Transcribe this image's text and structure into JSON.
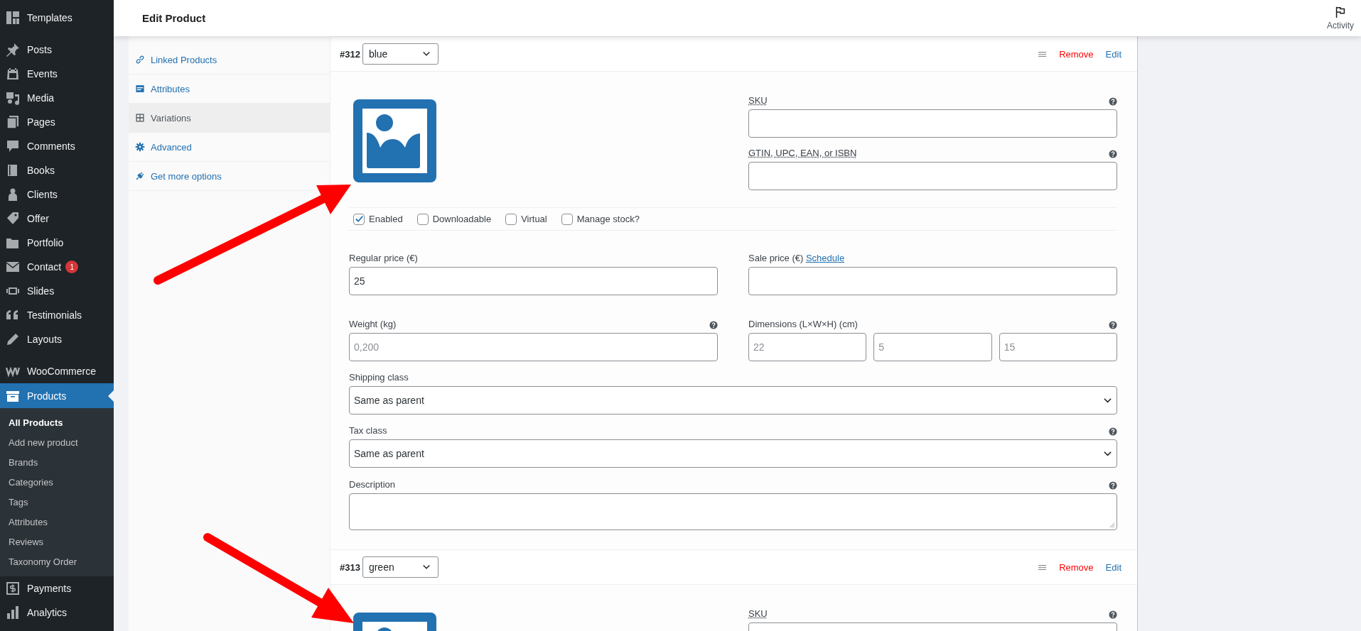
{
  "header": {
    "title": "Edit Product",
    "activity": "Activity"
  },
  "sidebar": {
    "groups": [
      [
        {
          "label": "Templates",
          "selected": false
        }
      ],
      [
        {
          "label": "Posts",
          "selected": false
        },
        {
          "label": "Events",
          "selected": false
        },
        {
          "label": "Media",
          "selected": false
        },
        {
          "label": "Pages",
          "selected": false
        },
        {
          "label": "Comments",
          "selected": false
        },
        {
          "label": "Books",
          "selected": false
        },
        {
          "label": "Clients",
          "selected": false
        },
        {
          "label": "Offer",
          "selected": false
        },
        {
          "label": "Portfolio",
          "selected": false
        },
        {
          "label": "Contact",
          "selected": false,
          "badge": "1"
        },
        {
          "label": "Slides",
          "selected": false
        },
        {
          "label": "Testimonials",
          "selected": false
        },
        {
          "label": "Layouts",
          "selected": false
        }
      ],
      [
        {
          "label": "WooCommerce",
          "selected": false
        },
        {
          "label": "Products",
          "selected": true,
          "submenu": [
            {
              "label": "All Products",
              "selected": true
            },
            {
              "label": "Add new product",
              "selected": false
            },
            {
              "label": "Brands",
              "selected": false
            },
            {
              "label": "Categories",
              "selected": false
            },
            {
              "label": "Tags",
              "selected": false
            },
            {
              "label": "Attributes",
              "selected": false
            },
            {
              "label": "Reviews",
              "selected": false
            },
            {
              "label": "Taxonomy Order",
              "selected": false
            }
          ]
        },
        {
          "label": "Payments",
          "selected": false
        },
        {
          "label": "Analytics",
          "selected": false
        }
      ]
    ]
  },
  "product_tabs": [
    {
      "label": "Linked Products",
      "selected": false
    },
    {
      "label": "Attributes",
      "selected": false
    },
    {
      "label": "Variations",
      "selected": true
    },
    {
      "label": "Advanced",
      "selected": false
    },
    {
      "label": "Get more options",
      "selected": false
    }
  ],
  "variations": [
    {
      "number": "#312",
      "attribute": "blue",
      "remove": "Remove",
      "edit": "Edit",
      "sku": {
        "label": "SKU",
        "help": true
      },
      "gtin": {
        "label": "GTIN, UPC, EAN, or ISBN",
        "help": true
      },
      "options": [
        {
          "label": "Enabled",
          "checked": true
        },
        {
          "label": "Downloadable",
          "checked": false
        },
        {
          "label": "Virtual",
          "checked": false
        },
        {
          "label": "Manage stock?",
          "checked": false
        }
      ],
      "regular_price": {
        "label": "Regular price (€)",
        "value": "25",
        "help": false
      },
      "sale_price": {
        "label": "Sale price (€)",
        "link": "Schedule",
        "help": false
      },
      "weight": {
        "label": "Weight (kg)",
        "placeholder": "0,200",
        "help": true
      },
      "dimensions": {
        "label": "Dimensions (L×W×H) (cm)",
        "placeholders": [
          "22",
          "5",
          "15"
        ],
        "help": true
      },
      "shipping_class": {
        "label": "Shipping class",
        "value": "Same as parent",
        "help": false
      },
      "tax_class": {
        "label": "Tax class",
        "value": "Same as parent",
        "help": true
      },
      "description": {
        "label": "Description",
        "help": true
      }
    },
    {
      "number": "#313",
      "attribute": "green",
      "remove": "Remove",
      "edit": "Edit",
      "sku": {
        "label": "SKU",
        "help": true
      }
    }
  ]
}
